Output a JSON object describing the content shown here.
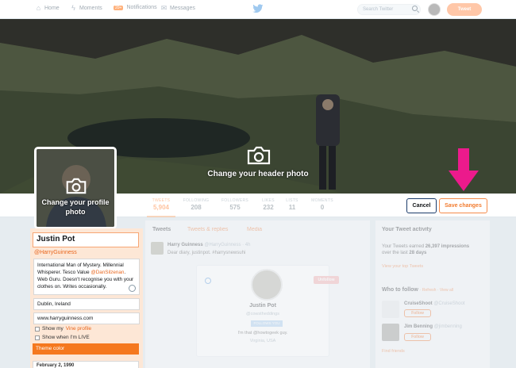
{
  "nav": {
    "items": [
      {
        "label": "Home",
        "icon": "home-icon"
      },
      {
        "label": "Moments",
        "icon": "lightning-icon"
      },
      {
        "label": "Notifications",
        "icon": "bell-icon",
        "badge": "20+"
      },
      {
        "label": "Messages",
        "icon": "envelope-icon"
      }
    ],
    "search_placeholder": "Search Twitter",
    "tweet_button": "Tweet"
  },
  "header": {
    "caption": "Change your header photo"
  },
  "profile_photo": {
    "caption": "Change your profile photo"
  },
  "stats": [
    {
      "label": "TWEETS",
      "value": "5,904"
    },
    {
      "label": "FOLLOWING",
      "value": "208"
    },
    {
      "label": "FOLLOWERS",
      "value": "575"
    },
    {
      "label": "LIKES",
      "value": "232"
    },
    {
      "label": "LISTS",
      "value": "11"
    },
    {
      "label": "MOMENTS",
      "value": "0"
    }
  ],
  "buttons": {
    "cancel": "Cancel",
    "save": "Save changes"
  },
  "edit": {
    "name": "Justin Pot",
    "handle": "@HarryGuinness",
    "bio_part1": "International Man of Mystery. Millennial Whisperer. Tesco Value ",
    "bio_mention": "@DanSilzenan",
    "bio_part2": ". Web Guru. Doesn't recognise you with your clothes on. Writes occasionally.",
    "location": "Dublin, Ireland",
    "website": "www.harryguinness.com",
    "vine_prefix": "Show my ",
    "vine_link": "Vine profile",
    "live_label": "Show when I'm LIVE",
    "theme_color": "Theme color",
    "birthday": "February 2, 1990"
  },
  "tweets": {
    "tabs": [
      "Tweets",
      "Tweets & replies",
      "Media"
    ],
    "author": "Harry Guinness",
    "author_meta": "@HarryGuinness · 4h",
    "text": "Dear diary, justinpot. #harrysnewsuhi",
    "card": {
      "name": "Justin Pot",
      "handle": "@cowstheddings",
      "badge": "FOLLOWS YOU",
      "bio": "I'm that @howtogeek guy.",
      "location": "Virginia, USA",
      "action": "Unfollow"
    }
  },
  "sidebar": {
    "activity_title": "Your Tweet activity",
    "activity_text_1": "Your Tweets earned ",
    "activity_impressions": "26,397 impressions",
    "activity_text_2": "over the last ",
    "activity_days": "28 days",
    "activity_link": "View your top Tweets",
    "wtf_title": "Who to follow",
    "wtf_links": "· Refresh · View all",
    "suggestions": [
      {
        "name": "CruiseShoot",
        "handle": "@CruiseShoot",
        "follow": "Follow"
      },
      {
        "name": "Jim Benning",
        "handle": "@jimbenning",
        "follow": "Follow"
      }
    ],
    "find_friends": "Find friends"
  },
  "colors": {
    "accent": "#f5781e",
    "arrow": "#ec1a8c",
    "link_blue": "#1da1f2"
  }
}
